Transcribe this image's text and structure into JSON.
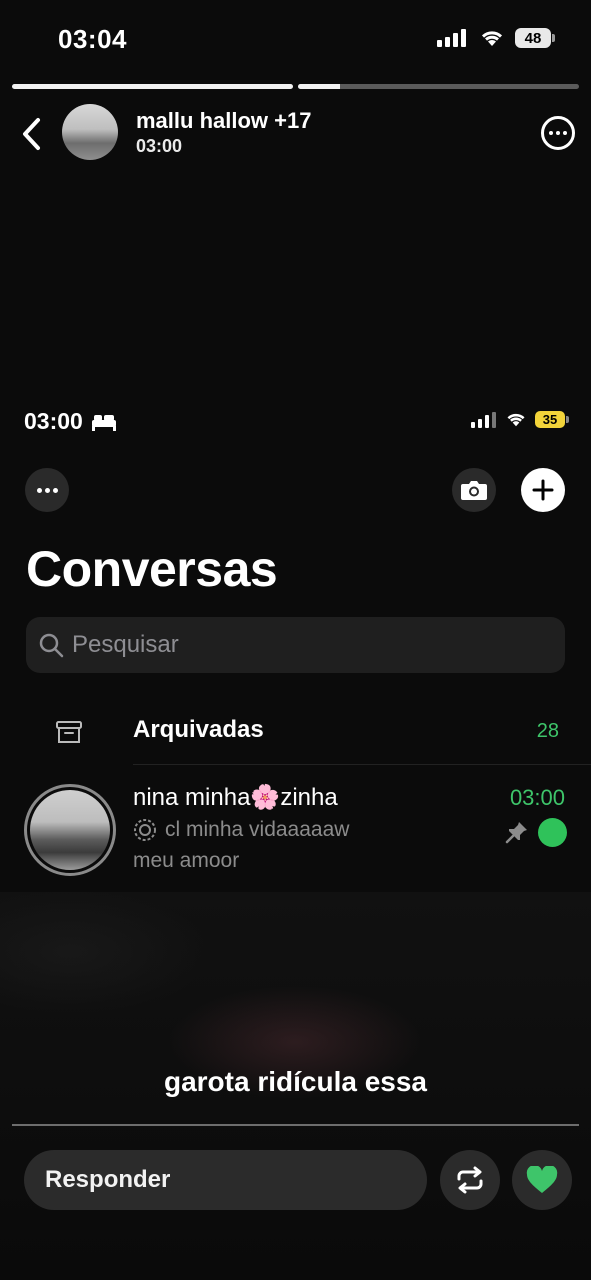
{
  "status_bar": {
    "time": "03:04",
    "battery": "48"
  },
  "story": {
    "progress": [
      1.0,
      0.15
    ],
    "username": "mallu hallow +17",
    "posted_time": "03:00",
    "caption": "garota ridícula essa",
    "reply_placeholder": "Responder"
  },
  "screenshot": {
    "status_bar": {
      "time": "03:00",
      "battery": "35"
    },
    "title": "Conversas",
    "search_placeholder": "Pesquisar",
    "archived": {
      "label": "Arquivadas",
      "count": "28"
    },
    "chats": [
      {
        "name_before": "nina minha ",
        "name_emoji": "🌸",
        "name_after": "zinha",
        "time": "03:00",
        "preview": "cl minha vidaaaaaw",
        "preview2": "meu amoor"
      }
    ]
  },
  "colors": {
    "accent_green": "#3ec56a",
    "background": "#0b0b0b"
  },
  "icons": [
    "back-icon",
    "more-icon",
    "camera-icon",
    "plus-icon",
    "search-icon",
    "archive-icon",
    "pin-icon",
    "repost-icon",
    "heart-icon"
  ]
}
